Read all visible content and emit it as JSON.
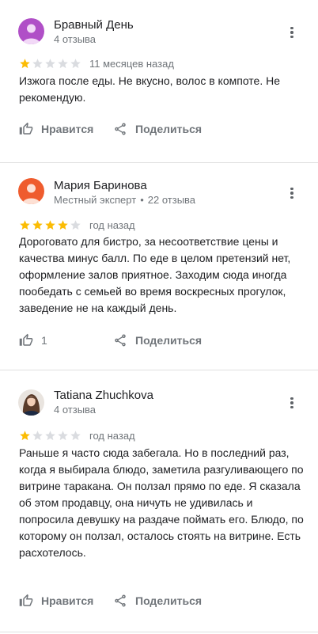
{
  "colors": {
    "star_filled": "#fbbc04",
    "star_empty": "#dadce0",
    "secondary_text": "#70757a",
    "avatar_purple": "#b04fc7",
    "avatar_orange": "#ef5c2e"
  },
  "reviews": [
    {
      "author": "Бравный День",
      "meta": "4 отзыва",
      "badge": "",
      "rating": 1,
      "time": "11 месяцев назад",
      "text": "Изжога после еды. Не вкусно, волос в компоте. Не рекомендую.",
      "like_label": "Нравится",
      "share_label": "Поделиться",
      "avatar_icon": "person-silhouette-icon"
    },
    {
      "author": "Мария Баринова",
      "badge": "Местный эксперт",
      "separator": "•",
      "meta": "22 отзыва",
      "rating": 4,
      "time": "год назад",
      "text": "Дороговато для бистро, за несоответствие цены и качества минус балл. По еде в целом претензий нет, оформление залов приятное. Заходим сюда иногда пообедать с семьей во время воскресных прогулок, заведение не на каждый день.",
      "like_count": "1",
      "share_label": "Поделиться",
      "avatar_icon": "person-silhouette-icon"
    },
    {
      "author": "Tatiana Zhuchkova",
      "meta": "4 отзыва",
      "badge": "",
      "rating": 1,
      "time": "год назад",
      "text": "Раньше я часто сюда забегала. Но в последний раз, когда я выбирала блюдо, заметила разгуливающего по витрине таракана. Он ползал прямо по еде. Я сказала об этом продавцу, она ничуть не удивилась и попросила девушку на раздаче поймать его. Блюдо, по которому он ползал, осталось стоять на витрине. Есть расхотелось.",
      "like_label": "Нравится",
      "share_label": "Поделиться",
      "avatar_icon": "profile-photo"
    }
  ]
}
